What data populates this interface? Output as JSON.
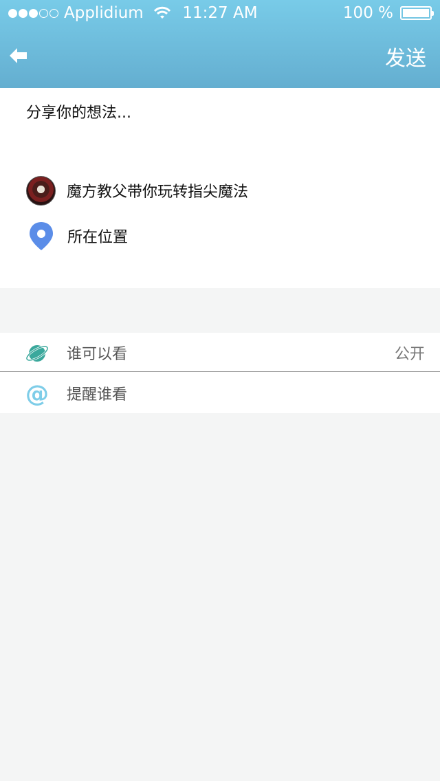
{
  "status_bar": {
    "carrier": "Applidium",
    "time": "11:27 AM",
    "battery": "100 %",
    "signal_icon": "signal-dots-icon",
    "wifi_icon": "wifi-icon",
    "battery_icon": "battery-icon"
  },
  "nav": {
    "back_icon": "back-arrow-icon",
    "send_label": "发送"
  },
  "compose": {
    "placeholder": "分享你的想法..."
  },
  "attachment": {
    "title": "魔方教父带你玩转指尖魔法",
    "icon": "avatar"
  },
  "location": {
    "label": "所在位置",
    "icon": "location-pin-icon"
  },
  "options": [
    {
      "label": "谁可以看",
      "value": "公开",
      "icon": "planet-icon"
    },
    {
      "label": "提醒谁看",
      "value": "",
      "icon": "at-icon"
    }
  ],
  "colors": {
    "header_top": "#78cbe8",
    "header_bottom": "#64aed0",
    "pin_blue": "#5b8de8",
    "planet_teal": "#3aa89c",
    "at_blue": "#7ecde8",
    "background": "#f4f5f5"
  }
}
